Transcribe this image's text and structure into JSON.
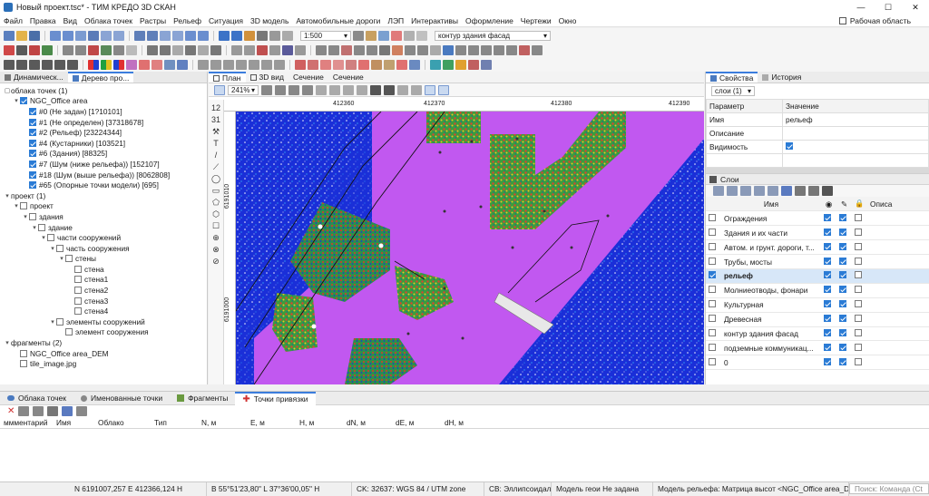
{
  "window": {
    "title": "Новый проект.tsc* - ТИМ КРЕДО 3D СКАН",
    "min": "—",
    "max": "☐",
    "close": "✕"
  },
  "menu": {
    "items": [
      "Файл",
      "Правка",
      "Вид",
      "Облака точек",
      "Растры",
      "Рельеф",
      "Ситуация",
      "3D модель",
      "Автомобильные дороги",
      "ЛЭП",
      "Интерактивы",
      "Оформление",
      "Чертежи",
      "Окно"
    ],
    "workspace": "Рабочая область"
  },
  "toolbar": {
    "scale": "1:500",
    "layer_combo": "контур здания фасад"
  },
  "left_panel": {
    "tabs": [
      "Динамическ...",
      "Дерево про..."
    ],
    "tree": [
      {
        "level": 0,
        "twisty": "▢",
        "check": false,
        "label": "облака точек (1)",
        "nocb": true
      },
      {
        "level": 1,
        "twisty": "▾",
        "check": true,
        "label": "NGC_Office area"
      },
      {
        "level": 2,
        "twisty": "",
        "check": true,
        "label": "#0 (Не задан) [1?10101]"
      },
      {
        "level": 2,
        "twisty": "",
        "check": true,
        "label": "#1 (Не определен) [37318678]"
      },
      {
        "level": 2,
        "twisty": "",
        "check": true,
        "label": "#2 (Рельеф) [23224344]"
      },
      {
        "level": 2,
        "twisty": "",
        "check": true,
        "label": "#4 (Кустарники) [103521]"
      },
      {
        "level": 2,
        "twisty": "",
        "check": true,
        "label": "#6 (Здания) [88325]"
      },
      {
        "level": 2,
        "twisty": "",
        "check": true,
        "label": "#7 (Шум (ниже рельефа)) [152107]"
      },
      {
        "level": 2,
        "twisty": "",
        "check": true,
        "label": "#18 (Шум (выше рельефа)) [8062808]"
      },
      {
        "level": 2,
        "twisty": "",
        "check": true,
        "label": "#65 (Опорные точки модели) [695]"
      },
      {
        "level": 0,
        "twisty": "▾",
        "check": false,
        "label": "проект (1)",
        "nocb": true
      },
      {
        "level": 1,
        "twisty": "▾",
        "check": false,
        "label": "проект"
      },
      {
        "level": 2,
        "twisty": "▾",
        "check": false,
        "label": "здания"
      },
      {
        "level": 3,
        "twisty": "▾",
        "check": false,
        "label": "здание"
      },
      {
        "level": 4,
        "twisty": "▾",
        "check": false,
        "label": "части сооружений"
      },
      {
        "level": 5,
        "twisty": "▾",
        "check": false,
        "label": "часть сооружения"
      },
      {
        "level": 6,
        "twisty": "▾",
        "check": false,
        "label": "стены"
      },
      {
        "level": 7,
        "twisty": "",
        "check": false,
        "label": "стена"
      },
      {
        "level": 7,
        "twisty": "",
        "check": false,
        "label": "стена1"
      },
      {
        "level": 7,
        "twisty": "",
        "check": false,
        "label": "стена2"
      },
      {
        "level": 7,
        "twisty": "",
        "check": false,
        "label": "стена3"
      },
      {
        "level": 7,
        "twisty": "",
        "check": false,
        "label": "стена4"
      },
      {
        "level": 5,
        "twisty": "▾",
        "check": false,
        "label": "элементы сооружений"
      },
      {
        "level": 6,
        "twisty": "",
        "check": false,
        "label": "элемент сооружения"
      },
      {
        "level": 0,
        "twisty": "▾",
        "check": false,
        "label": "фрагменты (2)",
        "nocb": true
      },
      {
        "level": 1,
        "twisty": "",
        "check": false,
        "label": "NGC_Office area_DEM"
      },
      {
        "level": 1,
        "twisty": "",
        "check": false,
        "label": "tile_image.jpg"
      }
    ]
  },
  "view": {
    "tabs": [
      "План",
      "3D вид",
      "Сечение",
      "Сечение"
    ],
    "zoom": "241%",
    "ruler_x": [
      "412360",
      "412370",
      "412380",
      "412390"
    ],
    "ruler_y": [
      "6191010",
      "6191000"
    ],
    "tool_glyphs": [
      "12",
      "31",
      "⚒",
      "T",
      "/",
      "⟋",
      "◯",
      "▭",
      "⬠",
      "⬡",
      "☐",
      "⊕",
      "⊗",
      "⊘"
    ]
  },
  "right_panel": {
    "tabs": [
      "Свойства",
      "История"
    ],
    "selector": "слои (1)",
    "prop_head": [
      "Параметр",
      "Значение"
    ],
    "props": [
      {
        "k": "Имя",
        "v": "рельеф"
      },
      {
        "k": "Описание",
        "v": ""
      },
      {
        "k": "Видимость",
        "v": ""
      },
      {
        "k": "",
        "v": ""
      }
    ],
    "layers_title": "Слои",
    "layers_head": [
      "Имя",
      "Описа"
    ],
    "layers": [
      {
        "name": "Ограждения",
        "c1": false,
        "eye": true,
        "edit": true,
        "lock": false
      },
      {
        "name": "Здания и их части",
        "c1": false,
        "eye": true,
        "edit": true,
        "lock": false
      },
      {
        "name": "Автом. и грунт. дороги, т...",
        "c1": false,
        "eye": true,
        "edit": true,
        "lock": false
      },
      {
        "name": "Трубы, мосты",
        "c1": false,
        "eye": true,
        "edit": true,
        "lock": false
      },
      {
        "name": "рельеф",
        "c1": true,
        "eye": true,
        "edit": true,
        "lock": false,
        "hl": true
      },
      {
        "name": "Молниеотводы, фонари",
        "c1": false,
        "eye": true,
        "edit": true,
        "lock": false
      },
      {
        "name": "Культурная",
        "c1": false,
        "eye": true,
        "edit": true,
        "lock": false
      },
      {
        "name": "Древесная",
        "c1": false,
        "eye": true,
        "edit": true,
        "lock": false
      },
      {
        "name": "контур здания фасад",
        "c1": false,
        "eye": true,
        "edit": true,
        "lock": false
      },
      {
        "name": "подземные коммуникац...",
        "c1": false,
        "eye": true,
        "edit": true,
        "lock": false
      },
      {
        "name": "0",
        "c1": false,
        "eye": true,
        "edit": true,
        "lock": false
      }
    ]
  },
  "bottom_panel": {
    "tabs": [
      "Облака точек",
      "Именованные точки",
      "Фрагменты",
      "Точки привязки"
    ],
    "columns": [
      "ммментарий",
      "Имя",
      "Облако",
      "Тип",
      "N, м",
      "E, м",
      "H, м",
      "dN, м",
      "dE, м",
      "dH, м"
    ]
  },
  "status": {
    "n": "N 6191007,257 E 412366,124 H",
    "b": "B 55°51'23,80\" L 37°36'00,05\" H",
    "ck": "CK: 32637: WGS 84 / UTM zone",
    "cb": "CB: Эллипсоидаль",
    "model": "Модель геои Не задана",
    "relief": "Модель рельефа: Матрица высот <NGC_Office area_DE",
    "search": "Поиск: Команда (Ct"
  },
  "colors": {
    "accent": "#3b7ddd",
    "building": "#c158f0",
    "cloud_blue": "#1830e0",
    "vegetation": "#3aa64a"
  }
}
